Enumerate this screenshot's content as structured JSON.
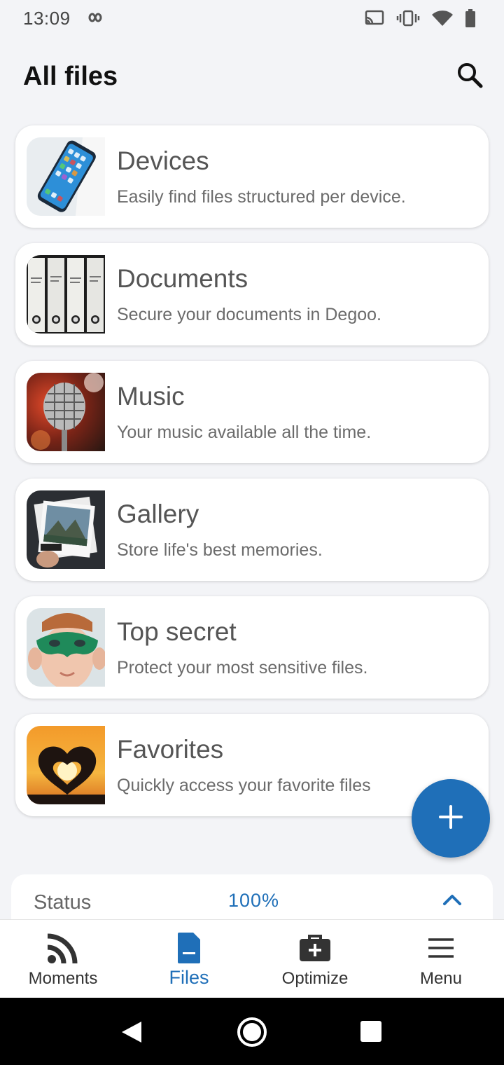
{
  "status_bar": {
    "time": "13:09"
  },
  "header": {
    "title": "All files"
  },
  "cards": [
    {
      "title": "Devices",
      "subtitle": "Easily find files structured per device."
    },
    {
      "title": "Documents",
      "subtitle": "Secure your documents in Degoo."
    },
    {
      "title": "Music",
      "subtitle": "Your music available all the time."
    },
    {
      "title": "Gallery",
      "subtitle": "Store life's best memories."
    },
    {
      "title": "Top secret",
      "subtitle": "Protect your most sensitive files."
    },
    {
      "title": "Favorites",
      "subtitle": "Quickly access your favorite files"
    }
  ],
  "status_panel": {
    "label": "Status",
    "value": "100%"
  },
  "bottom_nav": [
    {
      "label": "Moments",
      "icon": "rss-icon"
    },
    {
      "label": "Files",
      "icon": "file-icon",
      "active": true
    },
    {
      "label": "Optimize",
      "icon": "medkit-icon"
    },
    {
      "label": "Menu",
      "icon": "hamburger-icon"
    }
  ],
  "colors": {
    "accent": "#1f6fb8",
    "background": "#f3f4f7"
  }
}
